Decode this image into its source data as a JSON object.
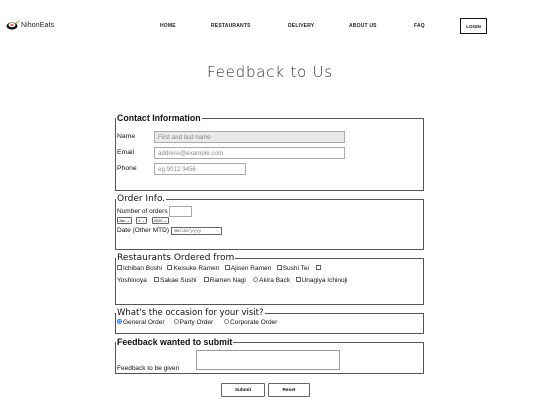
{
  "brand": {
    "name": "NihonEats"
  },
  "nav": {
    "items": [
      "HOME",
      "RESTAURANTS",
      "DELIVERY",
      "ABOUT US",
      "FAQ"
    ],
    "login": "LOGIN"
  },
  "title": "Feedback to Us",
  "contact": {
    "legend": "Contact Information",
    "name_label": "Name",
    "name_placeholder": "First and last name",
    "email_label": "Email",
    "email_placeholder": "address@example.com",
    "phone_label": "Phone",
    "phone_placeholder": "eg.9012 3456"
  },
  "order": {
    "legend": "Order Info.",
    "count_label": "Number of orders",
    "month": "Jan",
    "day": "1",
    "year": "2020",
    "date_label": "Date (Other MTD)",
    "date_placeholder": "mm/dd/yyyy"
  },
  "restaurants": {
    "legend": "Restaurants Ordered from",
    "options": [
      "Ichiban Boshi",
      "Keisuke Ramen",
      "Ajisen Ramen",
      "Sushi Tei",
      "Yoshinoya",
      "Sakae Sushi",
      "Ramen Nagi",
      "Akira Back",
      "Unagiya Ichinoji"
    ]
  },
  "occasion": {
    "legend": "What's the occasion for your visit?",
    "options": [
      "General Order",
      "Party Order",
      "Corporate Order"
    ],
    "selected": "General Order"
  },
  "feedback": {
    "legend": "Feedback wanted to submit",
    "label": "Feedback to be given"
  },
  "buttons": {
    "submit": "Submit",
    "reset": "Reset"
  },
  "colors": {
    "accent": "#1a73e8"
  }
}
